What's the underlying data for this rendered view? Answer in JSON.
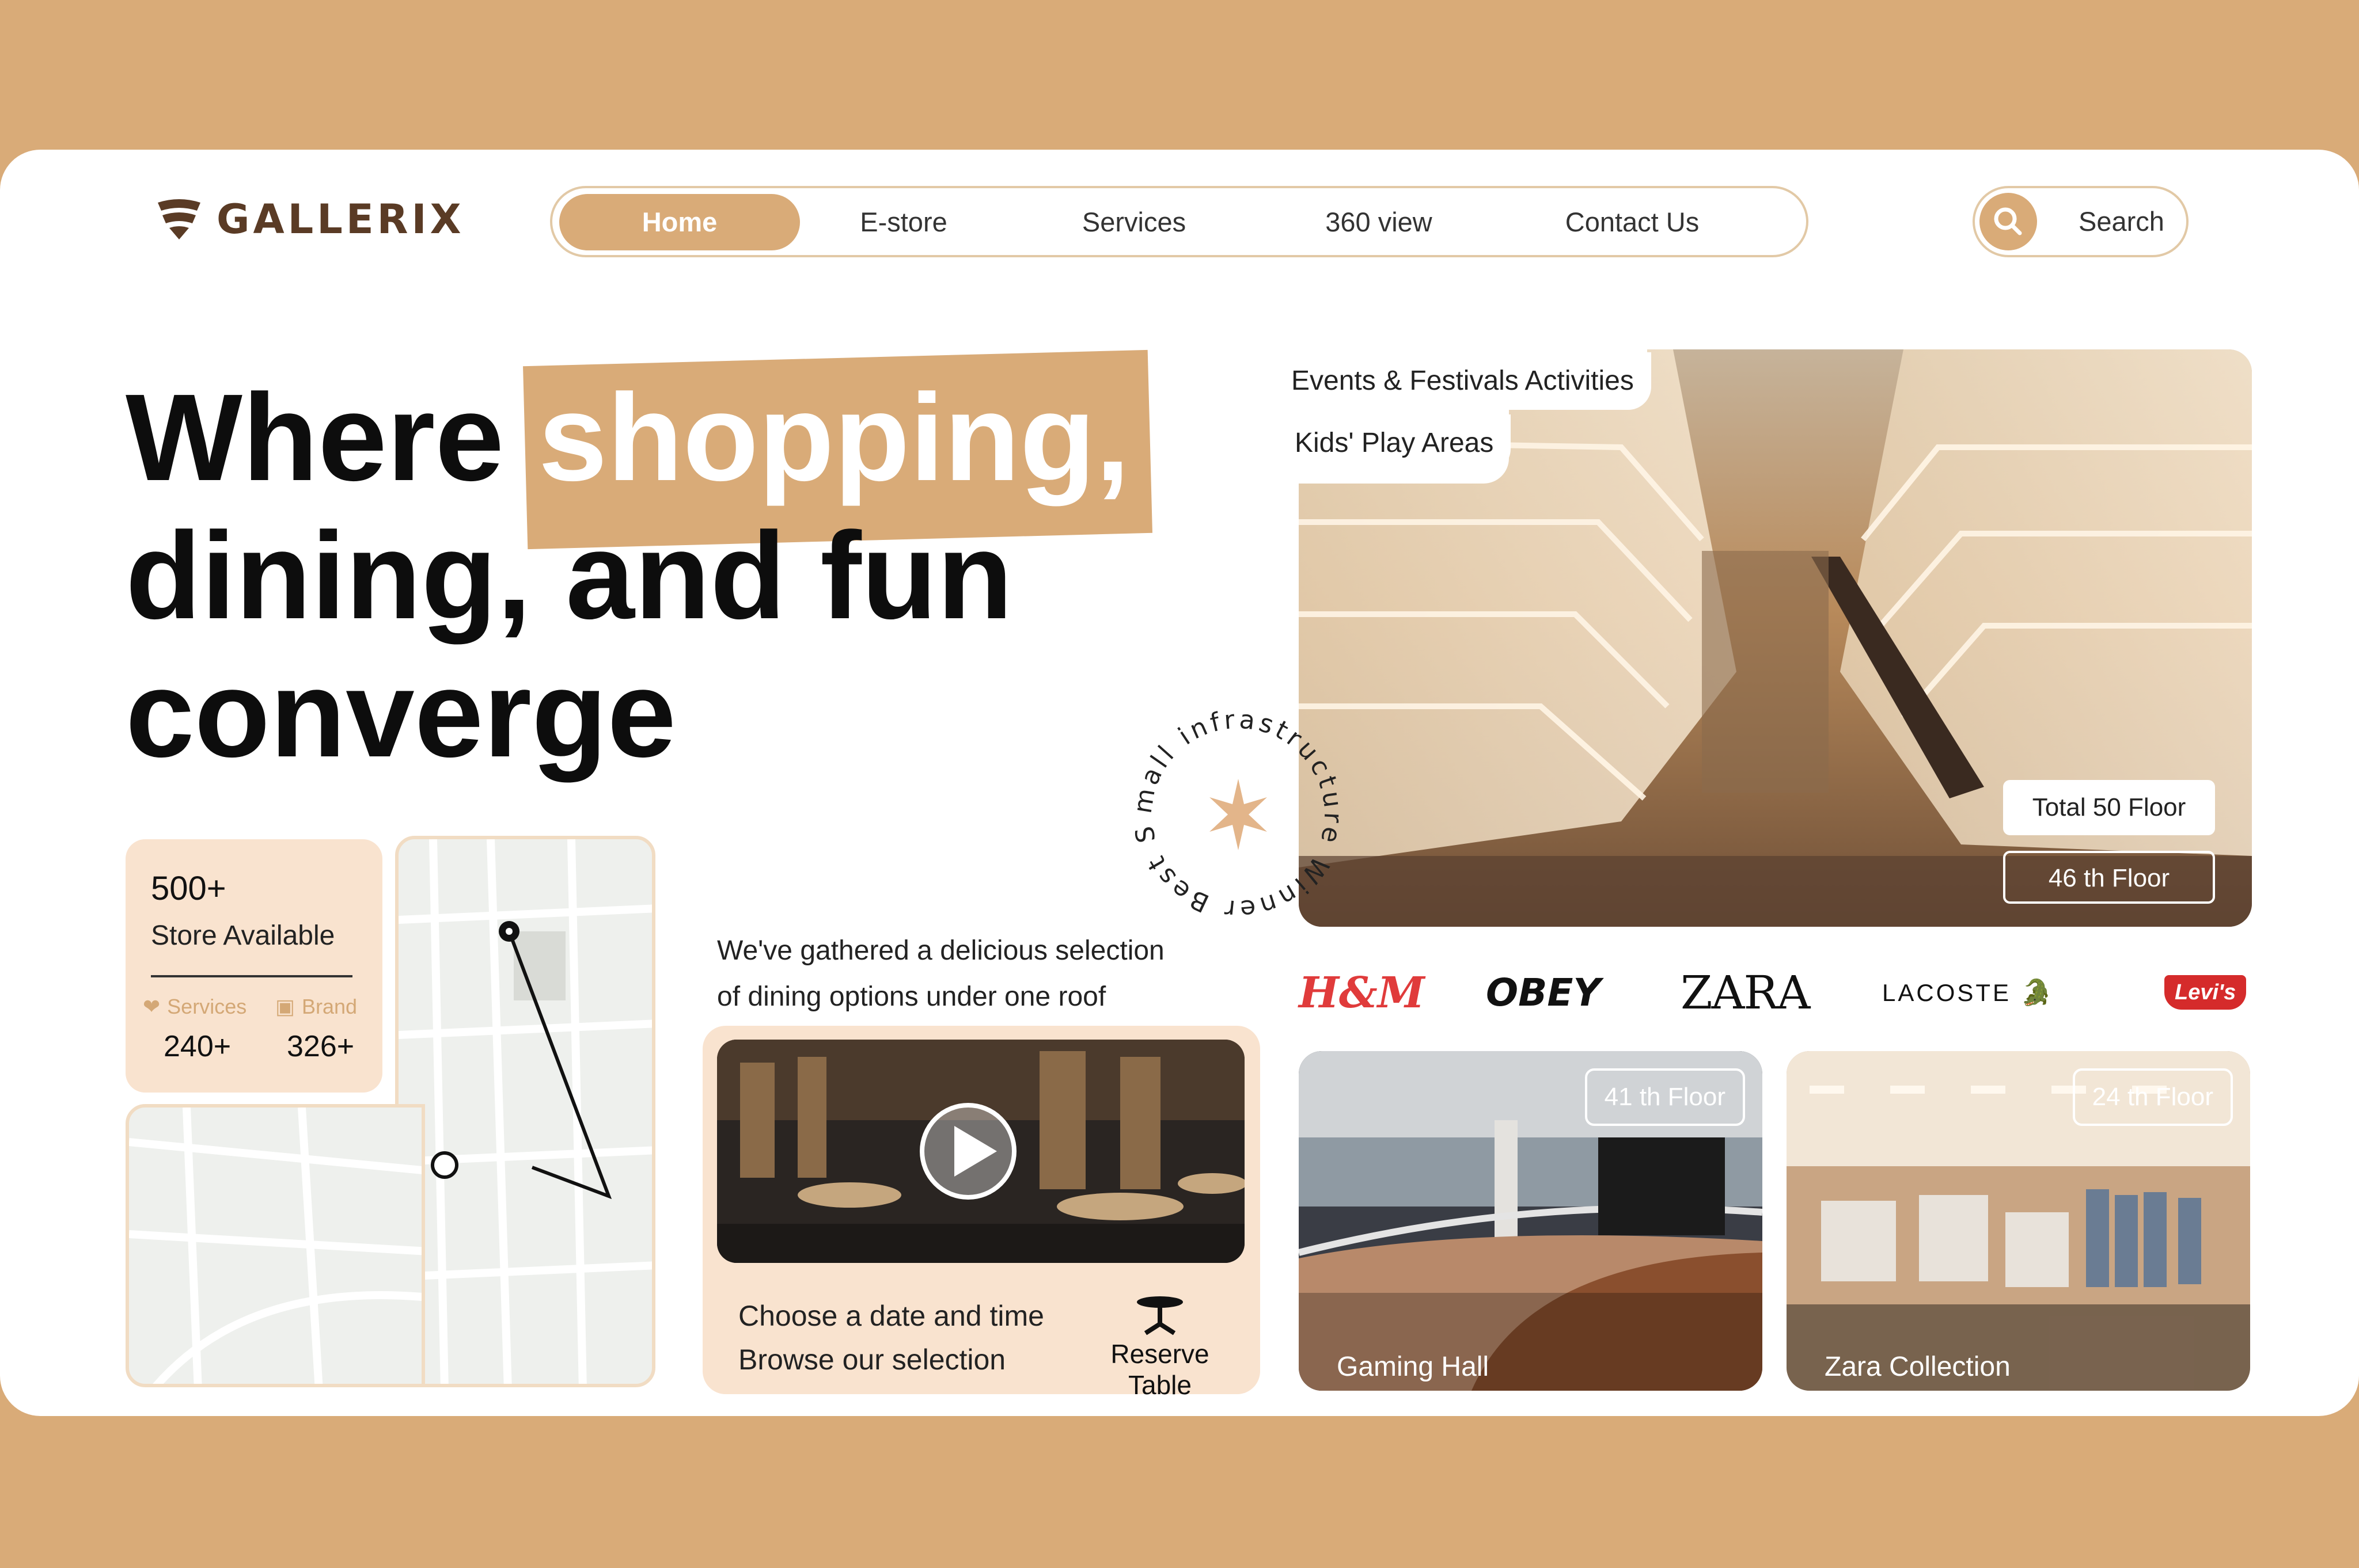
{
  "brand": {
    "name": "GALLERIX"
  },
  "nav": {
    "items": [
      {
        "label": "Home",
        "active": true
      },
      {
        "label": "E-store",
        "active": false
      },
      {
        "label": "Services",
        "active": false
      },
      {
        "label": "360 view",
        "active": false
      },
      {
        "label": "Contact Us",
        "active": false
      }
    ]
  },
  "search": {
    "label": "Search"
  },
  "hero": {
    "line1_prefix": "Where",
    "line1_highlight": "shopping,",
    "line2": "dining, and fun",
    "line3": "converge"
  },
  "tags": {
    "events": "Events & Festivals Activities",
    "kids": "Kids' Play Areas"
  },
  "badge": {
    "text": "mall infrastructure Winner Best Shopping"
  },
  "floors": {
    "total": "Total 50 Floor",
    "current": "46 th Floor"
  },
  "stats": {
    "count": "500+",
    "label": "Store Available",
    "services_label": "Services",
    "services_value": "240+",
    "brand_label": "Brand",
    "brand_value": "326+"
  },
  "dining": {
    "intro_line1": "We've gathered a delicious selection",
    "intro_line2": "of dining options under one roof",
    "line1": "Choose a date and time",
    "line2": "Browse our selection",
    "reserve": "Reserve Table"
  },
  "brands": [
    "H&M",
    "OBEY",
    "ZARA",
    "LACOSTE",
    "Levi's"
  ],
  "feature_cards": [
    {
      "floor": "41 th Floor",
      "title": "Gaming Hall"
    },
    {
      "floor": "24 th Floor",
      "title": "Zara Collection"
    }
  ],
  "colors": {
    "accent": "#d9ab78",
    "background": "#d9ab78",
    "card": "#ffffff",
    "pale": "#f9e3cf"
  }
}
